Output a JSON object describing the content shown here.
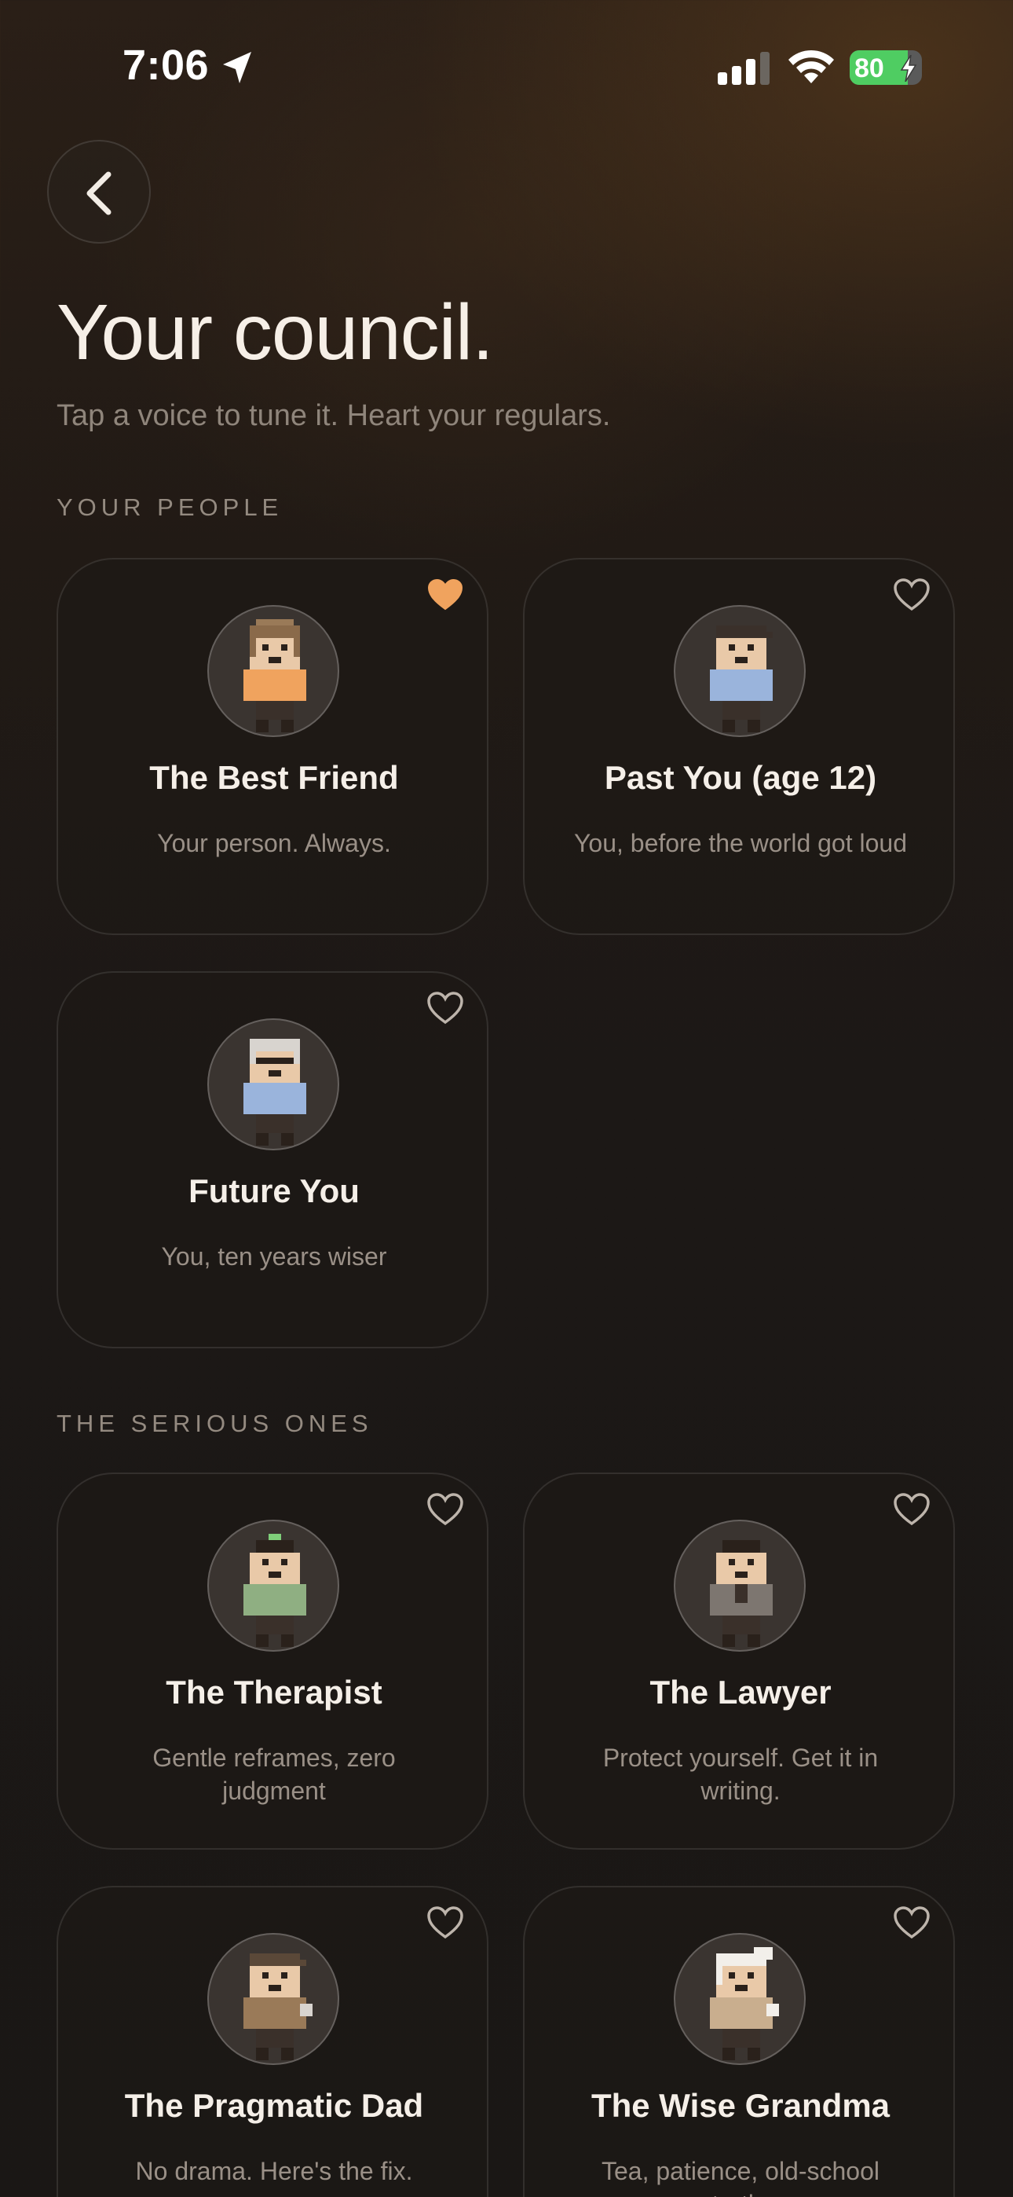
{
  "status_bar": {
    "time": "7:06",
    "battery": "80",
    "battery_level": 0.8,
    "icons": [
      "location-arrow-icon",
      "cellular-signal-icon",
      "wifi-icon",
      "battery-icon",
      "charging-bolt-icon"
    ]
  },
  "header": {
    "back_icon": "chevron-left-icon",
    "title": "Your council.",
    "subtitle": "Tap a voice to tune it. Heart your regulars."
  },
  "sections": [
    {
      "label": "YOUR PEOPLE",
      "cards": [
        {
          "name": "The Best Friend",
          "desc": "Your person. Always.",
          "favorited": true
        },
        {
          "name": "Past You (age 12)",
          "desc": "You, before the world got loud",
          "favorited": false
        },
        {
          "name": "Future You",
          "desc": "You, ten years wiser",
          "favorited": false
        }
      ]
    },
    {
      "label": "THE SERIOUS ONES",
      "cards": [
        {
          "name": "The Therapist",
          "desc": "Gentle reframes, zero judgment",
          "favorited": false
        },
        {
          "name": "The Lawyer",
          "desc": "Protect yourself. Get it in writing.",
          "favorited": false
        },
        {
          "name": "The Pragmatic Dad",
          "desc": "No drama. Here's the fix.",
          "favorited": false
        },
        {
          "name": "The Wise Grandma",
          "desc": "Tea, patience, old-school truth.",
          "favorited": false
        }
      ]
    }
  ],
  "colors": {
    "heart_active": "#f0a35e",
    "heart_inactive": "#bdb4ab",
    "battery_fill": "#4fcd62"
  }
}
